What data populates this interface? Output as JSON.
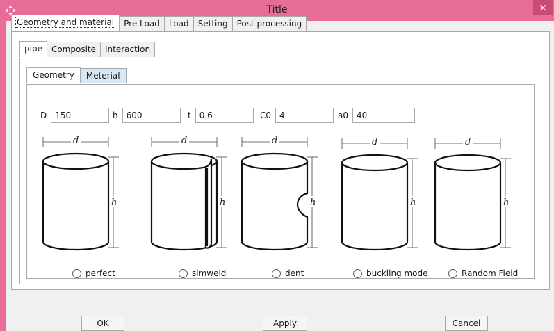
{
  "window": {
    "title": "Title",
    "close_glyph": "×"
  },
  "outer_tabs": [
    "Geometry and material",
    "Pre Load",
    "Load",
    "Setting",
    "Post processing"
  ],
  "mid_tabs": [
    "pipe",
    "Composite",
    "Interaction"
  ],
  "inner_tabs": [
    "Geometry",
    "Meterial"
  ],
  "params": [
    {
      "label": "D",
      "value": "150"
    },
    {
      "label": "h",
      "value": "600"
    },
    {
      "label": "t",
      "value": "0.6"
    },
    {
      "label": "C0",
      "value": "4"
    },
    {
      "label": "a0",
      "value": "40"
    }
  ],
  "figures": {
    "dim_d": "d",
    "dim_h": "h"
  },
  "options": [
    "perfect",
    "simweld",
    "dent",
    "buckling mode",
    "Random Field"
  ],
  "buttons": {
    "ok": "OK",
    "apply": "Apply",
    "cancel": "Cancel"
  },
  "colors": {
    "titlebar": "#e86c98",
    "close_button": "#c94b75",
    "active_inner_tab": "#d6e7f6"
  },
  "icons": {
    "app": "abaqus-plugin-icon",
    "close": "close-icon"
  }
}
